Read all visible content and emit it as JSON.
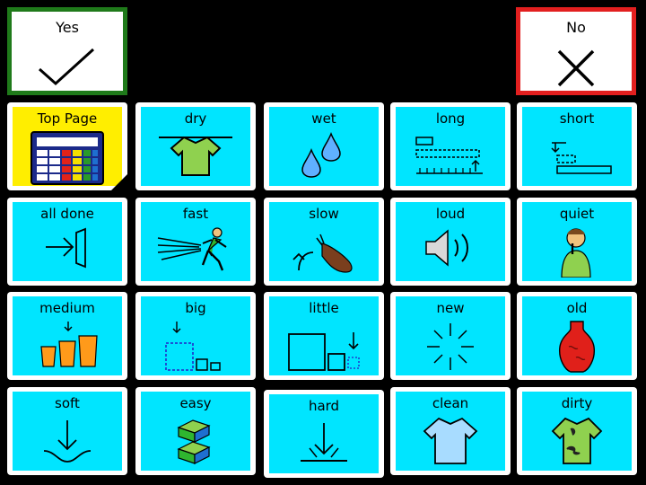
{
  "yes": {
    "label": "Yes"
  },
  "no": {
    "label": "No"
  },
  "grid": [
    {
      "label": "Top Page",
      "icon": "grid-board-icon"
    },
    {
      "label": "dry",
      "icon": "shirt-on-line-icon"
    },
    {
      "label": "wet",
      "icon": "water-drops-icon"
    },
    {
      "label": "long",
      "icon": "long-ruler-icon"
    },
    {
      "label": "short",
      "icon": "short-bar-icon"
    },
    {
      "label": "all done",
      "icon": "arrow-into-door-icon"
    },
    {
      "label": "fast",
      "icon": "running-man-icon"
    },
    {
      "label": "slow",
      "icon": "snail-icon"
    },
    {
      "label": "loud",
      "icon": "speaker-loud-icon"
    },
    {
      "label": "quiet",
      "icon": "person-shush-icon"
    },
    {
      "label": "medium",
      "icon": "three-cups-icon"
    },
    {
      "label": "big",
      "icon": "big-square-icon"
    },
    {
      "label": "little",
      "icon": "little-square-icon"
    },
    {
      "label": "new",
      "icon": "sparkle-icon"
    },
    {
      "label": "old",
      "icon": "vase-icon"
    },
    {
      "label": "soft",
      "icon": "soft-arrow-icon"
    },
    {
      "label": "easy",
      "icon": "easy-blocks-icon"
    },
    {
      "label": "hard",
      "icon": "hard-arrow-icon"
    },
    {
      "label": "clean",
      "icon": "clean-shirt-icon"
    },
    {
      "label": "dirty",
      "icon": "dirty-shirt-icon"
    }
  ]
}
